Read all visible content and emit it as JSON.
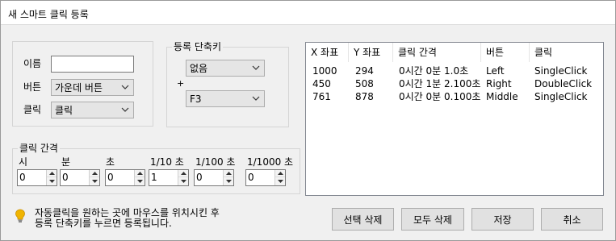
{
  "window": {
    "title": "새 스마트 클릭 등록"
  },
  "form": {
    "name_label": "이름",
    "name_value": "",
    "button_label": "버튼",
    "button_value": "가운데 버튼",
    "click_label": "클릭",
    "click_value": "클릭"
  },
  "hotkey": {
    "legend": "등록 단축키",
    "plus": "+",
    "modifier_value": "없음",
    "key_value": "F3"
  },
  "interval": {
    "legend": "클릭 간격",
    "fields": [
      {
        "label": "시",
        "value": "0"
      },
      {
        "label": "분",
        "value": "0"
      },
      {
        "label": "초",
        "value": "0"
      },
      {
        "label": "1/10 초",
        "value": "1"
      },
      {
        "label": "1/100 초",
        "value": "0"
      },
      {
        "label": "1/1000 초",
        "value": "0"
      }
    ]
  },
  "table": {
    "columns": [
      "X 좌표",
      "Y 좌표",
      "클릭 간격",
      "버튼",
      "클릭"
    ],
    "rows": [
      [
        "1000",
        "294",
        "0시간 0분 1.0초",
        "Left",
        "SingleClick"
      ],
      [
        "450",
        "508",
        "0시간 1분 2.100초",
        "Right",
        "DoubleClick"
      ],
      [
        "761",
        "878",
        "0시간 0분 0.100초",
        "Middle",
        "SingleClick"
      ]
    ]
  },
  "hint": {
    "icon": "lightbulb-icon",
    "text": "자동클릭을 원하는 곳에 마우스를 위치시킨 후\n등록 단축키를 누르면 등록됩니다."
  },
  "buttons": {
    "delete_selected": "선택 삭제",
    "delete_all": "모두 삭제",
    "save": "저장",
    "cancel": "취소"
  },
  "colors": {
    "hint_icon": "#f0b400"
  }
}
